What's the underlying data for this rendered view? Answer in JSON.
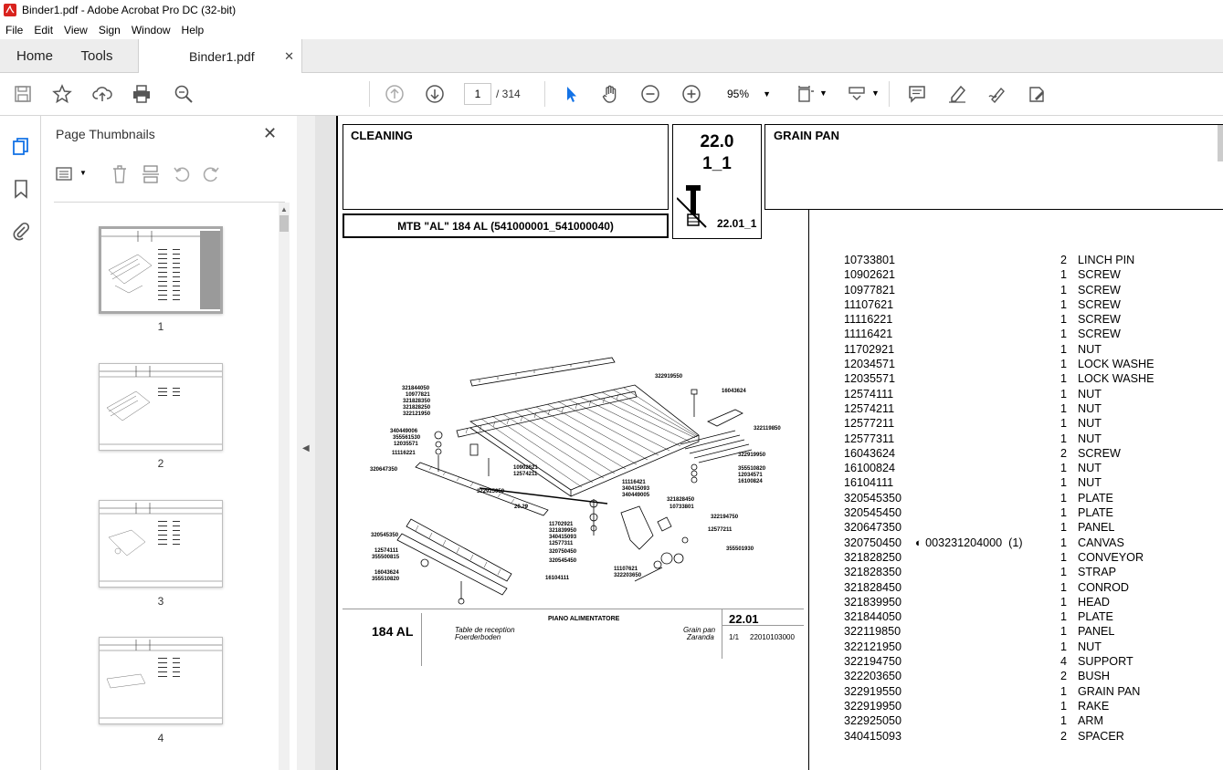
{
  "window": {
    "title": "Binder1.pdf - Adobe Acrobat Pro DC (32-bit)"
  },
  "menu": [
    "File",
    "Edit",
    "View",
    "Sign",
    "Window",
    "Help"
  ],
  "tabs": {
    "home": "Home",
    "tools": "Tools",
    "document": "Binder1.pdf"
  },
  "toolbar": {
    "current_page": "1",
    "page_total": "/ 314",
    "zoom": "95%"
  },
  "thumbnails": {
    "title": "Page Thumbnails",
    "pages": [
      {
        "label": "1",
        "selected": true
      },
      {
        "label": "2",
        "selected": false
      },
      {
        "label": "3",
        "selected": false
      },
      {
        "label": "4",
        "selected": false
      }
    ]
  },
  "document": {
    "section": "CLEANING",
    "code_main": "22.0",
    "code_sub": "1_1",
    "ref_code": "22.01_1",
    "group_title": "GRAIN PAN",
    "model": "MTB \"AL\" 184 AL (541000001_541000040)",
    "drawing": {
      "model_short": "184 AL",
      "italian_title": "PIANO ALIMENTATORE",
      "german_title": "Table de reception",
      "french_title": "Foerderboden",
      "english_title": "Grain pan",
      "spanish_title": "Zaranda",
      "code": "22.01",
      "sheet": "1/1",
      "drawing_number": "22010103000",
      "labels": [
        "322919550",
        "16043624",
        "321844050",
        "10977821",
        "321828350",
        "321828250",
        "322121950",
        "322119850",
        "340449006",
        "355561530",
        "12035571",
        "11116221",
        "322919950",
        "10902621",
        "12574211",
        "355510820",
        "12034571",
        "16100824",
        "320647350",
        "11116421",
        "340415093",
        "340449005",
        "322925050",
        "321828450",
        "20.29",
        "10733801",
        "322194750",
        "11702921",
        "321839950",
        "12577211",
        "340415093",
        "12577311",
        "320750450",
        "320545350",
        "355501930",
        "320545450",
        "12574111",
        "355500815",
        "11107621",
        "322203650",
        "16043624",
        "355510820",
        "16104111"
      ]
    },
    "parts": [
      {
        "number": "10733801",
        "qty": "2",
        "desc": "LINCH PIN"
      },
      {
        "number": "10902621",
        "qty": "1",
        "desc": "SCREW"
      },
      {
        "number": "10977821",
        "qty": "1",
        "desc": "SCREW"
      },
      {
        "number": "11107621",
        "qty": "1",
        "desc": "SCREW"
      },
      {
        "number": "11116221",
        "qty": "1",
        "desc": "SCREW"
      },
      {
        "number": "11116421",
        "qty": "1",
        "desc": "SCREW"
      },
      {
        "number": "11702921",
        "qty": "1",
        "desc": "NUT"
      },
      {
        "number": "12034571",
        "qty": "1",
        "desc": "LOCK WASHE"
      },
      {
        "number": "12035571",
        "qty": "1",
        "desc": "LOCK WASHE"
      },
      {
        "number": "12574111",
        "qty": "1",
        "desc": "NUT"
      },
      {
        "number": "12574211",
        "qty": "1",
        "desc": "NUT"
      },
      {
        "number": "12577211",
        "qty": "1",
        "desc": "NUT"
      },
      {
        "number": "12577311",
        "qty": "1",
        "desc": "NUT"
      },
      {
        "number": "16043624",
        "qty": "2",
        "desc": "SCREW"
      },
      {
        "number": "16100824",
        "qty": "1",
        "desc": "NUT"
      },
      {
        "number": "16104111",
        "qty": "1",
        "desc": "NUT"
      },
      {
        "number": "320545350",
        "qty": "1",
        "desc": "PLATE"
      },
      {
        "number": "320545450",
        "qty": "1",
        "desc": "PLATE"
      },
      {
        "number": "320647350",
        "qty": "1",
        "desc": "PANEL"
      },
      {
        "number": "320750450",
        "qty": "1",
        "desc": "CANVAS",
        "extra": "003231204000  (1)"
      },
      {
        "number": "321828250",
        "qty": "1",
        "desc": "CONVEYOR"
      },
      {
        "number": "321828350",
        "qty": "1",
        "desc": "STRAP"
      },
      {
        "number": "321828450",
        "qty": "1",
        "desc": "CONROD"
      },
      {
        "number": "321839950",
        "qty": "1",
        "desc": "HEAD"
      },
      {
        "number": "321844050",
        "qty": "1",
        "desc": "PLATE"
      },
      {
        "number": "322119850",
        "qty": "1",
        "desc": "PANEL"
      },
      {
        "number": "322121950",
        "qty": "1",
        "desc": "NUT"
      },
      {
        "number": "322194750",
        "qty": "4",
        "desc": "SUPPORT"
      },
      {
        "number": "322203650",
        "qty": "2",
        "desc": "BUSH"
      },
      {
        "number": "322919550",
        "qty": "1",
        "desc": "GRAIN PAN"
      },
      {
        "number": "322919950",
        "qty": "1",
        "desc": "RAKE"
      },
      {
        "number": "322925050",
        "qty": "1",
        "desc": "ARM"
      },
      {
        "number": "340415093",
        "qty": "2",
        "desc": "SPACER"
      }
    ]
  }
}
